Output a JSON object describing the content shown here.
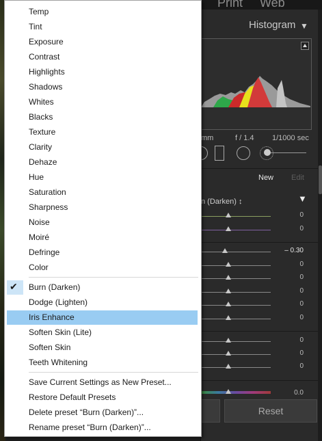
{
  "background": {
    "modules": [
      "Print",
      "Web"
    ],
    "histogram": {
      "title": "Histogram",
      "exif": [
        "mm",
        "f / 1.4",
        "1/1000 sec"
      ]
    },
    "masking": {
      "new_label": "New",
      "edit_label": "Edit"
    },
    "effect": {
      "label": "n (Darken) ↕"
    },
    "sliders": [
      {
        "value": "0"
      },
      {
        "value": "0"
      },
      {
        "value": "– 0.30"
      },
      {
        "value": "0"
      },
      {
        "value": "0"
      },
      {
        "value": "0"
      },
      {
        "value": "0"
      },
      {
        "value": "0"
      },
      {
        "value": "0"
      },
      {
        "value": "0"
      },
      {
        "value": "0"
      },
      {
        "value": "0.0"
      }
    ],
    "reset_label": "Reset"
  },
  "menu": {
    "adjustments": [
      "Temp",
      "Tint",
      "Exposure",
      "Contrast",
      "Highlights",
      "Shadows",
      "Whites",
      "Blacks",
      "Texture",
      "Clarity",
      "Dehaze",
      "Hue",
      "Saturation",
      "Sharpness",
      "Noise",
      "Moiré",
      "Defringe",
      "Color"
    ],
    "presets": [
      {
        "label": "Burn (Darken)",
        "checked": true
      },
      {
        "label": "Dodge (Lighten)"
      },
      {
        "label": "Iris Enhance",
        "highlighted": true
      },
      {
        "label": "Soften Skin (Lite)"
      },
      {
        "label": "Soften Skin"
      },
      {
        "label": "Teeth Whitening"
      }
    ],
    "actions": [
      "Save Current Settings as New Preset...",
      "Restore Default Presets",
      "Delete preset “Burn (Darken)”...",
      "Rename preset “Burn (Darken)”..."
    ]
  },
  "colors": {
    "highlight": "#99ccf2",
    "check_bg": "#cde5f7",
    "menu_bg": "#ffffff",
    "panel_bg": "#2a2a2a"
  }
}
